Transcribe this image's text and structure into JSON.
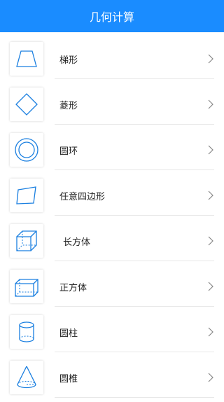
{
  "header": {
    "title": "几何计算"
  },
  "items": [
    {
      "label": "梯形",
      "icon": "trapezoid-icon"
    },
    {
      "label": "菱形",
      "icon": "rhombus-icon"
    },
    {
      "label": "圆环",
      "icon": "ring-icon"
    },
    {
      "label": "任意四边形",
      "icon": "quadrilateral-icon"
    },
    {
      "label": "长方体",
      "icon": "cuboid-icon"
    },
    {
      "label": "正方体",
      "icon": "cube-icon"
    },
    {
      "label": "圆柱",
      "icon": "cylinder-icon"
    },
    {
      "label": "圆椎",
      "icon": "cone-icon"
    }
  ],
  "colors": {
    "accent": "#1a8cff",
    "icon_stroke": "#1a7fe0"
  }
}
